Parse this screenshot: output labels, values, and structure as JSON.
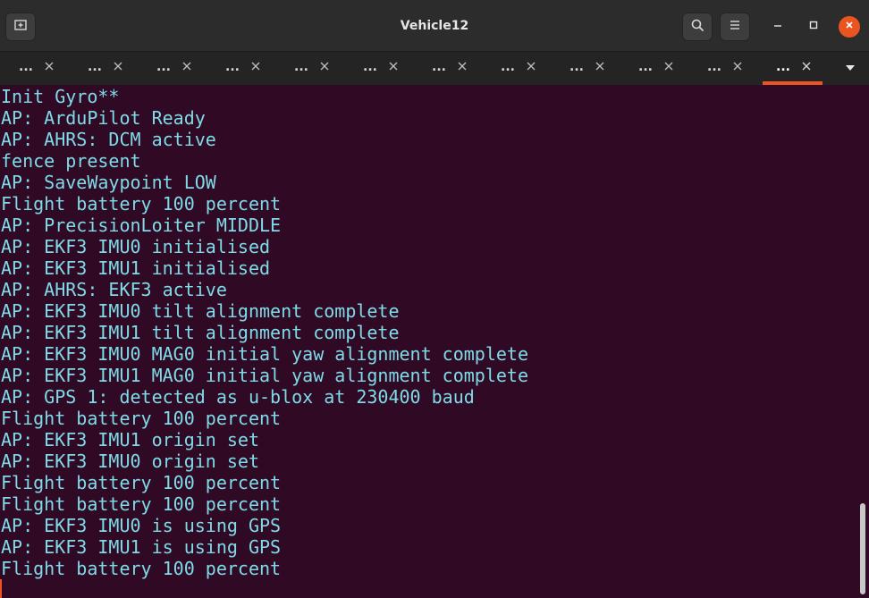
{
  "window": {
    "title": "Vehicle12"
  },
  "icons": {
    "new_tab": "new-tab-icon",
    "search": "search-icon",
    "menu": "hamburger-menu-icon",
    "minimize": "minimize-icon",
    "maximize": "maximize-icon",
    "close": "close-icon",
    "tab_close": "close-icon",
    "tab_dropdown": "chevron-down-icon"
  },
  "colors": {
    "accent": "#e95420",
    "terminal_bg": "#300a24",
    "terminal_text": "#7fdbe8",
    "titlebar_bg": "#2c2c2c",
    "tabbar_bg": "#242424"
  },
  "tabs": [
    {
      "label": "..."
    },
    {
      "label": "..."
    },
    {
      "label": "..."
    },
    {
      "label": "..."
    },
    {
      "label": "..."
    },
    {
      "label": "..."
    },
    {
      "label": "..."
    },
    {
      "label": "..."
    },
    {
      "label": "..."
    },
    {
      "label": "..."
    },
    {
      "label": "..."
    },
    {
      "label": "...",
      "active": true
    }
  ],
  "terminal": {
    "lines": [
      "Init Gyro**",
      "AP: ArduPilot Ready",
      "AP: AHRS: DCM active",
      "fence present",
      "AP: SaveWaypoint LOW",
      "Flight battery 100 percent",
      "AP: PrecisionLoiter MIDDLE",
      "AP: EKF3 IMU0 initialised",
      "AP: EKF3 IMU1 initialised",
      "AP: AHRS: EKF3 active",
      "AP: EKF3 IMU0 tilt alignment complete",
      "AP: EKF3 IMU1 tilt alignment complete",
      "AP: EKF3 IMU0 MAG0 initial yaw alignment complete",
      "AP: EKF3 IMU1 MAG0 initial yaw alignment complete",
      "AP: GPS 1: detected as u-blox at 230400 baud",
      "Flight battery 100 percent",
      "AP: EKF3 IMU1 origin set",
      "AP: EKF3 IMU0 origin set",
      "Flight battery 100 percent",
      "Flight battery 100 percent",
      "AP: EKF3 IMU0 is using GPS",
      "AP: EKF3 IMU1 is using GPS",
      "Flight battery 100 percent"
    ]
  }
}
